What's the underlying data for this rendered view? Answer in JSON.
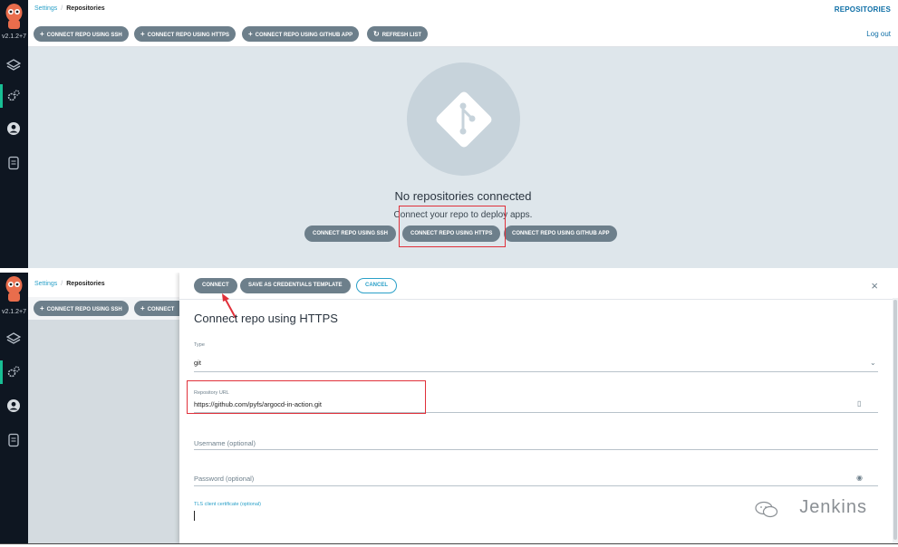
{
  "app": {
    "version": "v2.1.2+7",
    "breadcrumb": {
      "root": "Settings",
      "separator": "/",
      "current": "Repositories"
    },
    "page_title": "REPOSITORIES",
    "logout": "Log out"
  },
  "nav": {
    "items": [
      {
        "name": "layers-icon",
        "glyph": "⟐"
      },
      {
        "name": "gears-icon",
        "glyph": "⚙"
      },
      {
        "name": "user-icon",
        "glyph": "●"
      },
      {
        "name": "docs-icon",
        "glyph": "▤"
      }
    ]
  },
  "toolbar": {
    "connect_ssh": "CONNECT REPO USING SSH",
    "connect_https": "CONNECT REPO USING HTTPS",
    "connect_github_app": "CONNECT REPO USING GITHUB APP",
    "refresh": "REFRESH LIST",
    "connect_ssh_bottom": "CONNECT REPO USING SSH",
    "connect_https_bottom_truncated": "CONNECT"
  },
  "empty_state": {
    "title": "No repositories connected",
    "subtitle": "Connect your repo to deploy apps.",
    "btn_ssh": "CONNECT REPO USING SSH",
    "btn_https": "CONNECT REPO USING HTTPS",
    "btn_github_app": "CONNECT REPO USING GITHUB APP"
  },
  "panel": {
    "connect": "CONNECT",
    "save_template": "SAVE AS CREDENTIALS TEMPLATE",
    "cancel": "CANCEL",
    "close": "×",
    "title": "Connect repo using HTTPS",
    "type_label": "Type",
    "type_value": "git",
    "repo_url_label": "Repository URL",
    "repo_url_value": "https://github.com/pyfs/argocd-in-action.git",
    "username_placeholder": "Username (optional)",
    "password_placeholder": "Password (optional)",
    "tls_label": "TLS client certificate (optional)"
  },
  "watermark": "Jenkins",
  "colors": {
    "sidebar": "#0e1621",
    "accent": "#18be94",
    "pill": "#6d7f8b",
    "link": "#2aa0c8",
    "highlight": "#e0303a"
  }
}
